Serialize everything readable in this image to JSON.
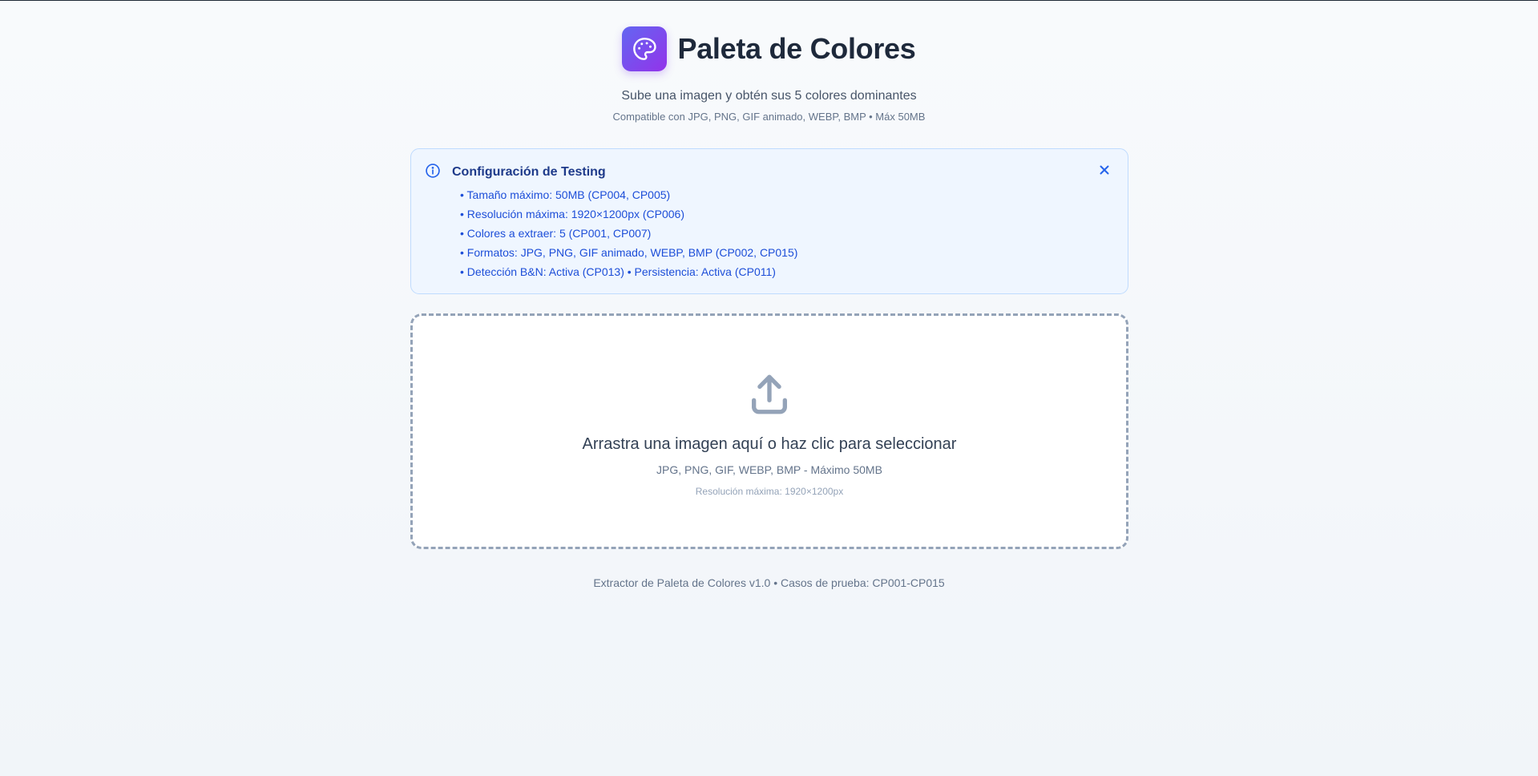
{
  "header": {
    "title": "Paleta de Colores",
    "logo_icon": "palette-icon",
    "subtitle": "Sube una imagen y obtén sus 5 colores dominantes",
    "compat": "Compatible con JPG, PNG, GIF animado, WEBP, BMP • Máx 50MB"
  },
  "info_box": {
    "icon": "info-icon",
    "title": "Configuración de Testing",
    "close_icon": "close-icon",
    "items": [
      "• Tamaño máximo: 50MB (CP004, CP005)",
      "• Resolución máxima: 1920×1200px (CP006)",
      "• Colores a extraer: 5 (CP001, CP007)",
      "• Formatos: JPG, PNG, GIF animado, WEBP, BMP (CP002, CP015)",
      "• Detección B&N: Activa (CP013) • Persistencia: Activa (CP011)"
    ]
  },
  "dropzone": {
    "icon": "upload-icon",
    "main_text": "Arrastra una imagen aquí o haz clic para seleccionar",
    "sub_text": "JPG, PNG, GIF, WEBP, BMP - Máximo 50MB",
    "resolution_text": "Resolución máxima: 1920×1200px"
  },
  "footer": {
    "text": "Extractor de Paleta de Colores v1.0 • Casos de prueba: CP001-CP015"
  },
  "colors": {
    "accent_start": "#6366f1",
    "accent_end": "#9333ea",
    "info_bg": "#eff6ff",
    "info_text": "#1d4ed8",
    "dropzone_border": "#94a3b8"
  }
}
